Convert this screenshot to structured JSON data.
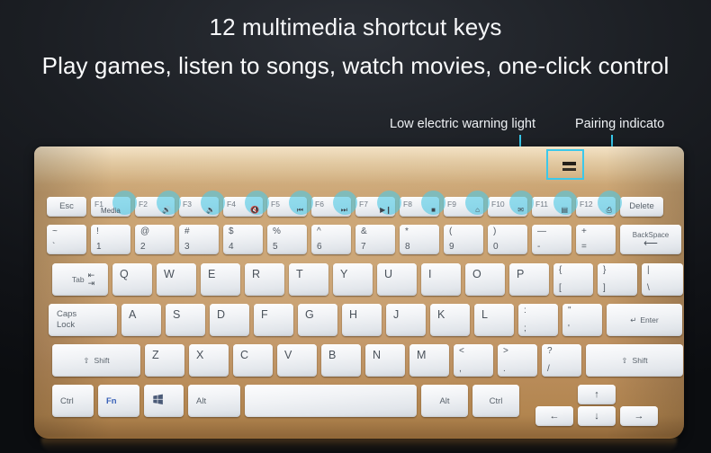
{
  "headline": {
    "line1": "12 multimedia shortcut keys",
    "line2": "Play games, listen to songs, watch movies, one-click control"
  },
  "callouts": [
    {
      "id": "low-electric",
      "label": "Low electric warning light"
    },
    {
      "id": "pairing",
      "label": "Pairing indicato"
    }
  ],
  "colors": {
    "accent_cyan": "#3cc8ea",
    "highlight_dot": "rgba(80,200,228,0.62)",
    "keyboard_gold": "#c49a67",
    "key_face": "#eef1f4",
    "background": "#14161a",
    "fn_blue": "#3a62b8"
  },
  "keyboard": {
    "indicators": [
      {
        "name": "low-electric-led"
      },
      {
        "name": "pairing-led"
      }
    ],
    "rows": {
      "function_row": [
        {
          "name": "esc",
          "label": "Esc",
          "highlight": false
        },
        {
          "name": "f1",
          "label": "F1",
          "sub": "Media",
          "icon": "",
          "highlight": true
        },
        {
          "name": "f2",
          "label": "F2",
          "icon": "volume-up-icon",
          "glyph": "🔊",
          "highlight": true
        },
        {
          "name": "f3",
          "label": "F3",
          "icon": "volume-down-icon",
          "glyph": "🔉",
          "highlight": true
        },
        {
          "name": "f4",
          "label": "F4",
          "icon": "volume-mute-icon",
          "glyph": "🔇",
          "highlight": true
        },
        {
          "name": "f5",
          "label": "F5",
          "icon": "previous-track-icon",
          "glyph": "⏮",
          "highlight": true
        },
        {
          "name": "f6",
          "label": "F6",
          "icon": "next-track-icon",
          "glyph": "⏭",
          "highlight": true
        },
        {
          "name": "f7",
          "label": "F7",
          "icon": "play-pause-icon",
          "glyph": "▶❙",
          "highlight": true
        },
        {
          "name": "f8",
          "label": "F8",
          "icon": "stop-icon",
          "glyph": "■",
          "highlight": true
        },
        {
          "name": "f9",
          "label": "F9",
          "icon": "home-icon",
          "glyph": "⌂",
          "highlight": true
        },
        {
          "name": "f10",
          "label": "F10",
          "icon": "mail-icon",
          "glyph": "✉",
          "highlight": true
        },
        {
          "name": "f11",
          "label": "F11",
          "icon": "browser-icon",
          "glyph": "▤",
          "highlight": true
        },
        {
          "name": "f12",
          "label": "F12",
          "icon": "my-computer-icon",
          "glyph": "⎙",
          "highlight": true
        },
        {
          "name": "delete",
          "label": "Delete",
          "highlight": false
        }
      ],
      "number_row": [
        {
          "name": "backtick",
          "top": "~",
          "bottom": "`"
        },
        {
          "name": "one",
          "top": "!",
          "bottom": "1"
        },
        {
          "name": "two",
          "top": "@",
          "bottom": "2"
        },
        {
          "name": "three",
          "top": "#",
          "bottom": "3"
        },
        {
          "name": "four",
          "top": "$",
          "bottom": "4"
        },
        {
          "name": "five",
          "top": "%",
          "bottom": "5"
        },
        {
          "name": "six",
          "top": "^",
          "bottom": "6"
        },
        {
          "name": "seven",
          "top": "&",
          "bottom": "7"
        },
        {
          "name": "eight",
          "top": "*",
          "bottom": "8"
        },
        {
          "name": "nine",
          "top": "(",
          "bottom": "9"
        },
        {
          "name": "zero",
          "top": ")",
          "bottom": "0"
        },
        {
          "name": "minus",
          "top": "—",
          "bottom": "-"
        },
        {
          "name": "equals",
          "top": "+",
          "bottom": "="
        },
        {
          "name": "backspace",
          "label": "BackSpace",
          "arrow": "⟵"
        }
      ],
      "top_letter_row": [
        {
          "name": "tab",
          "label": "Tab",
          "arrow_top": "⇤",
          "arrow_bottom": "⇥"
        },
        {
          "name": "q",
          "label": "Q"
        },
        {
          "name": "w",
          "label": "W"
        },
        {
          "name": "e",
          "label": "E"
        },
        {
          "name": "r",
          "label": "R"
        },
        {
          "name": "t",
          "label": "T"
        },
        {
          "name": "y",
          "label": "Y"
        },
        {
          "name": "u",
          "label": "U"
        },
        {
          "name": "i",
          "label": "I"
        },
        {
          "name": "o",
          "label": "O"
        },
        {
          "name": "p",
          "label": "P"
        },
        {
          "name": "bracket-left",
          "top": "{",
          "bottom": "["
        },
        {
          "name": "bracket-right",
          "top": "}",
          "bottom": "]"
        },
        {
          "name": "backslash",
          "top": "|",
          "bottom": "\\"
        }
      ],
      "home_row": [
        {
          "name": "caps-lock",
          "label_line1": "Caps",
          "label_line2": "Lock"
        },
        {
          "name": "a",
          "label": "A"
        },
        {
          "name": "s",
          "label": "S"
        },
        {
          "name": "d",
          "label": "D"
        },
        {
          "name": "f",
          "label": "F"
        },
        {
          "name": "g",
          "label": "G"
        },
        {
          "name": "h",
          "label": "H"
        },
        {
          "name": "j",
          "label": "J"
        },
        {
          "name": "k",
          "label": "K"
        },
        {
          "name": "l",
          "label": "L"
        },
        {
          "name": "semicolon",
          "top": ":",
          "bottom": ";"
        },
        {
          "name": "quote",
          "top": "\"",
          "bottom": "'"
        },
        {
          "name": "enter",
          "label": "Enter",
          "arrow": "↵"
        }
      ],
      "bottom_letter_row": [
        {
          "name": "shift-left",
          "label": "Shift",
          "icon": "shift-arrow-icon",
          "glyph": "⇧"
        },
        {
          "name": "z",
          "label": "Z"
        },
        {
          "name": "x",
          "label": "X"
        },
        {
          "name": "c",
          "label": "C"
        },
        {
          "name": "v",
          "label": "V"
        },
        {
          "name": "b",
          "label": "B"
        },
        {
          "name": "n",
          "label": "N"
        },
        {
          "name": "m",
          "label": "M"
        },
        {
          "name": "comma",
          "top": "<",
          "bottom": ","
        },
        {
          "name": "period",
          "top": ">",
          "bottom": "."
        },
        {
          "name": "slash",
          "top": "?",
          "bottom": "/"
        },
        {
          "name": "shift-right",
          "label": "Shift",
          "icon": "shift-arrow-icon",
          "glyph": "⇧"
        }
      ],
      "modifier_row": [
        {
          "name": "ctrl-left",
          "label": "Ctrl"
        },
        {
          "name": "fn",
          "label": "Fn"
        },
        {
          "name": "windows",
          "label": "",
          "icon": "windows-icon",
          "glyph": "⊞"
        },
        {
          "name": "alt-left",
          "label": "Alt"
        },
        {
          "name": "space",
          "label": ""
        },
        {
          "name": "alt-right",
          "label": "Alt"
        },
        {
          "name": "ctrl-right",
          "label": "Ctrl"
        },
        {
          "name": "arrow-left",
          "label": "←"
        },
        {
          "name": "arrow-up",
          "label": "↑"
        },
        {
          "name": "arrow-down",
          "label": "↓"
        },
        {
          "name": "arrow-right",
          "label": "→"
        }
      ]
    }
  }
}
